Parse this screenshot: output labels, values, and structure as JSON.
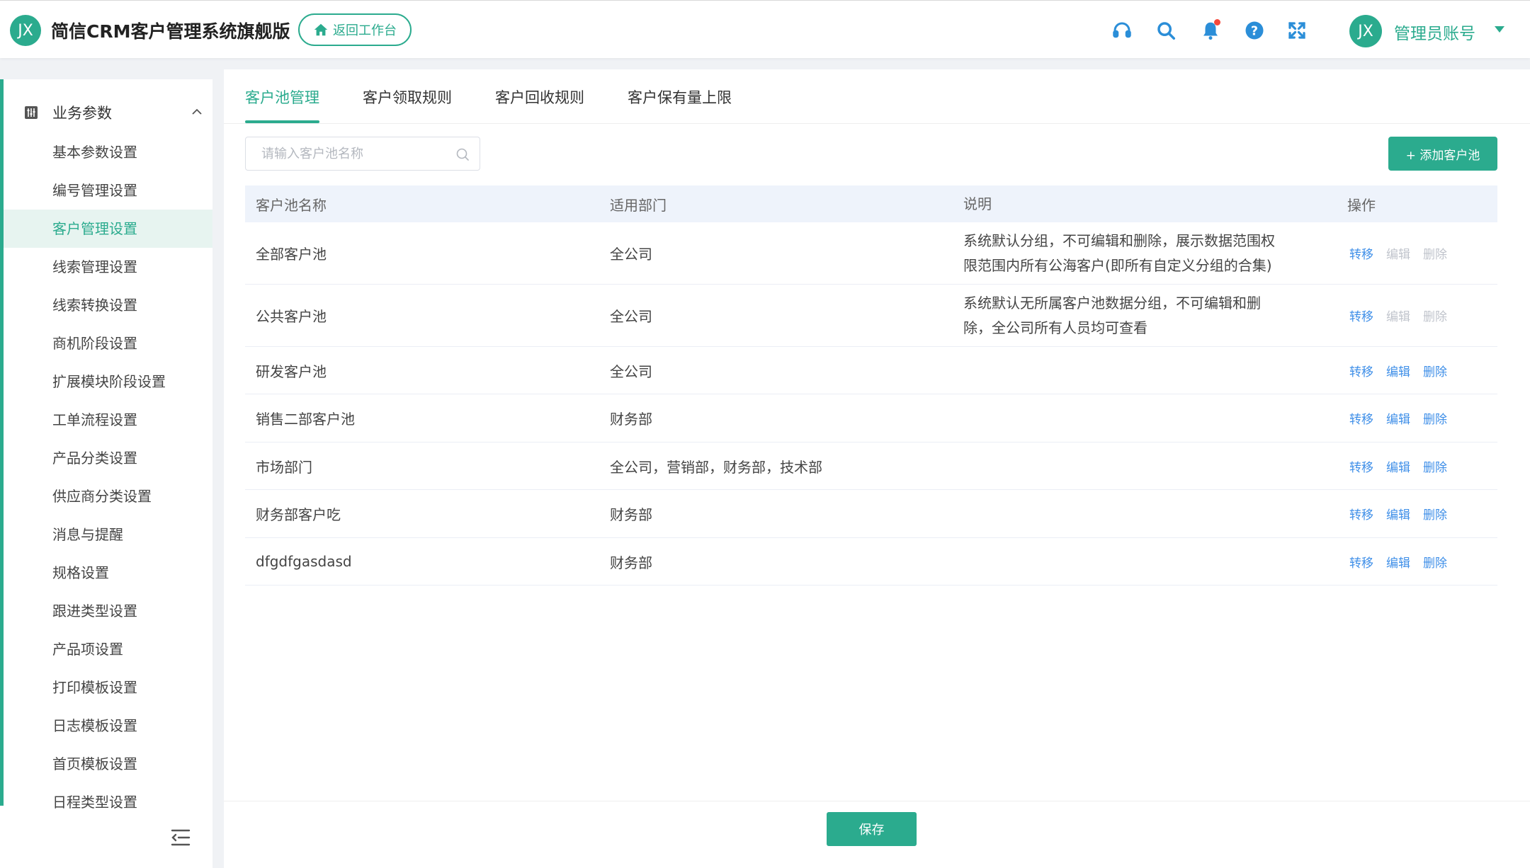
{
  "app": {
    "logo_text": "JX",
    "title": "简信CRM客户管理系统旗舰版",
    "back_label": "返回工作台"
  },
  "header": {
    "icons": [
      "headset-icon",
      "search-icon",
      "bell-icon",
      "help-icon",
      "fullscreen-icon"
    ],
    "user": {
      "avatar_text": "JX",
      "name": "管理员账号"
    }
  },
  "sidebar": {
    "group_label": "业务参数",
    "items": [
      {
        "label": "基本参数设置"
      },
      {
        "label": "编号管理设置"
      },
      {
        "label": "客户管理设置",
        "active": true
      },
      {
        "label": "线索管理设置"
      },
      {
        "label": "线索转换设置"
      },
      {
        "label": "商机阶段设置"
      },
      {
        "label": "扩展模块阶段设置"
      },
      {
        "label": "工单流程设置"
      },
      {
        "label": "产品分类设置"
      },
      {
        "label": "供应商分类设置"
      },
      {
        "label": "消息与提醒"
      },
      {
        "label": "规格设置"
      },
      {
        "label": "跟进类型设置"
      },
      {
        "label": "产品项设置"
      },
      {
        "label": "打印模板设置"
      },
      {
        "label": "日志模板设置"
      },
      {
        "label": "首页模板设置"
      },
      {
        "label": "日程类型设置"
      }
    ]
  },
  "tabs": [
    {
      "label": "客户池管理",
      "active": true
    },
    {
      "label": "客户领取规则"
    },
    {
      "label": "客户回收规则"
    },
    {
      "label": "客户保有量上限"
    }
  ],
  "toolbar": {
    "search_placeholder": "请输入客户池名称",
    "add_label": "+ 添加客户池"
  },
  "table": {
    "headers": {
      "name": "客户池名称",
      "dept": "适用部门",
      "desc": "说明",
      "ops": "操作"
    },
    "op_labels": {
      "transfer": "转移",
      "edit": "编辑",
      "delete": "删除"
    },
    "rows": [
      {
        "name": "全部客户池",
        "dept": "全公司",
        "desc": [
          "系统默认分组，不可编辑和删除，展示数据范围权",
          "限范围内所有公海客户(即所有自定义分组的合集)"
        ],
        "editable": false
      },
      {
        "name": "公共客户池",
        "dept": "全公司",
        "desc": [
          "系统默认无所属客户池数据分组，不可编辑和删",
          "除，全公司所有人员均可查看"
        ],
        "editable": false
      },
      {
        "name": "研发客户池",
        "dept": "全公司",
        "desc": [],
        "editable": true
      },
      {
        "name": "销售二部客户池",
        "dept": "财务部",
        "desc": [],
        "editable": true
      },
      {
        "name": "市场部门",
        "dept": "全公司，营销部，财务部，技术部",
        "desc": [],
        "editable": true
      },
      {
        "name": "财务部客户吃",
        "dept": "财务部",
        "desc": [],
        "editable": true
      },
      {
        "name": "dfgdfgasdasd",
        "dept": "财务部",
        "desc": [],
        "editable": true
      }
    ]
  },
  "footer": {
    "save_label": "保存"
  }
}
